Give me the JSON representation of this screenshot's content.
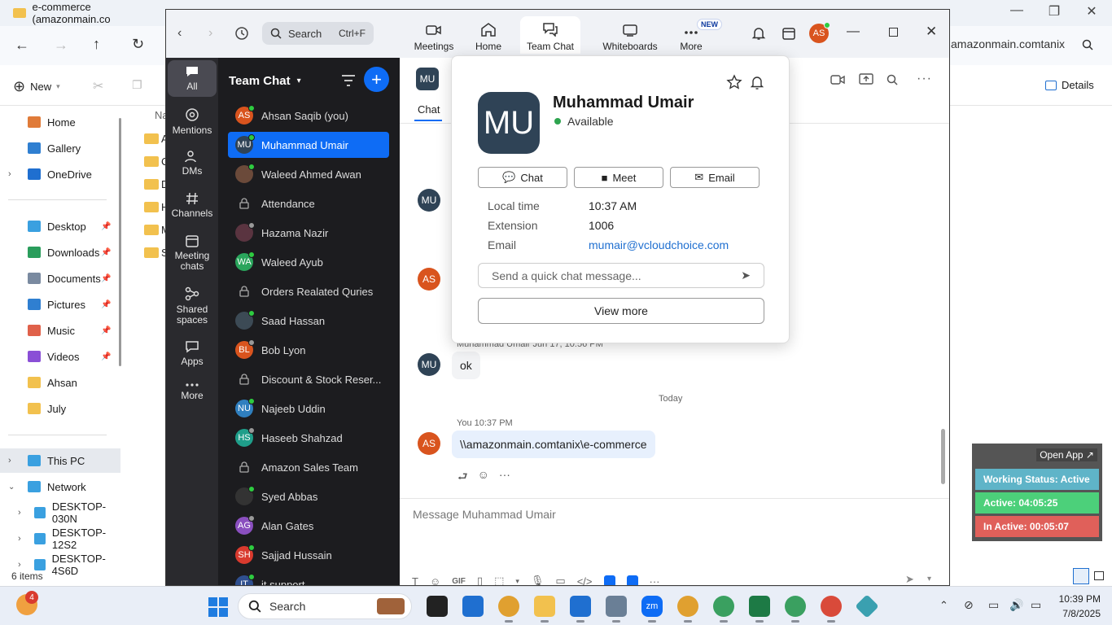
{
  "explorer": {
    "tab_title": "e-commerce (amazonmain.co",
    "address_tail": "amazonmain.comtanix",
    "new_label": "New",
    "details_label": "Details",
    "column_header": "Na",
    "status_items": "6 items",
    "folder_letters": [
      "A",
      "C",
      "D",
      "H",
      "M",
      "S"
    ],
    "sidebar": [
      {
        "label": "Home",
        "icon": "home-icon",
        "color": "#e07b39"
      },
      {
        "label": "Gallery",
        "icon": "gallery-icon",
        "color": "#2f7fd1"
      },
      {
        "label": "OneDrive",
        "icon": "cloud-icon",
        "color": "#1f6fd0"
      },
      {
        "label": "Desktop",
        "icon": "desktop-icon",
        "color": "#3aa0e0"
      },
      {
        "label": "Downloads",
        "icon": "download-icon",
        "color": "#2a9d5c"
      },
      {
        "label": "Documents",
        "icon": "document-icon",
        "color": "#7a8aa0"
      },
      {
        "label": "Pictures",
        "icon": "picture-icon",
        "color": "#2f7fd1"
      },
      {
        "label": "Music",
        "icon": "music-icon",
        "color": "#e0614a"
      },
      {
        "label": "Videos",
        "icon": "video-icon",
        "color": "#8a4fd6"
      },
      {
        "label": "Ahsan",
        "icon": "folder-icon",
        "color": "#f2c14e"
      },
      {
        "label": "July",
        "icon": "folder-icon",
        "color": "#f2c14e"
      },
      {
        "label": "This PC",
        "icon": "pc-icon",
        "color": "#3aa0e0"
      },
      {
        "label": "Network",
        "icon": "network-icon",
        "color": "#3aa0e0"
      },
      {
        "label": "DESKTOP-030N",
        "icon": "monitor-icon",
        "color": "#3aa0e0"
      },
      {
        "label": "DESKTOP-12S2",
        "icon": "monitor-icon",
        "color": "#3aa0e0"
      },
      {
        "label": "DESKTOP-4S6D",
        "icon": "monitor-icon",
        "color": "#3aa0e0"
      }
    ]
  },
  "zoom": {
    "search_label": "Search",
    "search_shortcut": "Ctrl+F",
    "nav": [
      {
        "label": "Meetings",
        "icon": "camera-icon"
      },
      {
        "label": "Home",
        "icon": "home-icon"
      },
      {
        "label": "Team Chat",
        "icon": "chat-icon"
      },
      {
        "label": "Whiteboards",
        "icon": "whiteboard-icon"
      },
      {
        "label": "More",
        "icon": "more-icon",
        "badge": "NEW"
      }
    ],
    "user_initials": "AS",
    "rail": [
      {
        "label": "All",
        "icon": "chat-bubble-icon"
      },
      {
        "label": "Mentions",
        "icon": "at-icon"
      },
      {
        "label": "DMs",
        "icon": "people-icon"
      },
      {
        "label": "Channels",
        "icon": "hash-icon"
      },
      {
        "label": "Meeting chats",
        "icon": "calendar-icon"
      },
      {
        "label": "Shared spaces",
        "icon": "share-icon"
      },
      {
        "label": "Apps",
        "icon": "apps-icon"
      },
      {
        "label": "More",
        "icon": "ellipsis-icon"
      }
    ],
    "list_title": "Team Chat",
    "contacts": [
      {
        "name": "Ahsan Saqib (you)",
        "initials": "AS",
        "color": "#d9541e",
        "dot": "#2ecc40",
        "type": "avatar"
      },
      {
        "name": "Muhammad Umair",
        "initials": "MU",
        "color": "#2f4356",
        "dot": "#2ecc40",
        "type": "avatar"
      },
      {
        "name": "Waleed Ahmed Awan",
        "initials": "",
        "color": "#6b4a3a",
        "dot": "#2ecc40",
        "type": "photo"
      },
      {
        "name": "Attendance",
        "initials": "",
        "color": "",
        "dot": "",
        "type": "channel"
      },
      {
        "name": "Hazama Nazir",
        "initials": "",
        "color": "#5a3440",
        "dot": "#999",
        "type": "photo"
      },
      {
        "name": "Waleed Ayub",
        "initials": "WA",
        "color": "#2aa55c",
        "dot": "#2ecc40",
        "type": "avatar"
      },
      {
        "name": "Orders Realated Quries",
        "initials": "",
        "color": "",
        "dot": "",
        "type": "channel"
      },
      {
        "name": "Saad Hassan",
        "initials": "",
        "color": "#3c4a55",
        "dot": "#2ecc40",
        "type": "photo"
      },
      {
        "name": "Bob Lyon",
        "initials": "BL",
        "color": "#d9541e",
        "dot": "#999",
        "type": "avatar"
      },
      {
        "name": "Discount & Stock Reser...",
        "initials": "",
        "color": "",
        "dot": "",
        "type": "channel"
      },
      {
        "name": "Najeeb Uddin",
        "initials": "NU",
        "color": "#2f7fbf",
        "dot": "#2ecc40",
        "type": "avatar"
      },
      {
        "name": "Haseeb Shahzad",
        "initials": "HS",
        "color": "#1f9e8a",
        "dot": "#999",
        "type": "avatar"
      },
      {
        "name": "Amazon Sales Team",
        "initials": "",
        "color": "",
        "dot": "",
        "type": "channel"
      },
      {
        "name": "Syed Abbas",
        "initials": "",
        "color": "#333",
        "dot": "#2ecc40",
        "type": "photo"
      },
      {
        "name": "Alan Gates",
        "initials": "AG",
        "color": "#8a4fbf",
        "dot": "#999",
        "type": "avatar"
      },
      {
        "name": "Sajjad Hussain",
        "initials": "SH",
        "color": "#d93a2e",
        "dot": "#2ecc40",
        "type": "avatar"
      },
      {
        "name": "it support",
        "initials": "IT",
        "color": "#2f4f8f",
        "dot": "#2ecc40",
        "type": "avatar"
      }
    ],
    "chat_header_initials": "MU",
    "chat_tab": "Chat",
    "messages": [
      {
        "meta": "Muhammad Umair  Jun 17, 10:56 PM",
        "text": "ok",
        "initials": "MU"
      },
      {
        "meta": "You  10:37 PM",
        "text": "\\\\amazonmain.comtanix\\e-commerce",
        "initials": "AS"
      }
    ],
    "day_divider": "Today",
    "composer_placeholder": "Message Muhammad Umair",
    "composer_gif": "GIF"
  },
  "popup": {
    "initials": "MU",
    "name": "Muhammad Umair",
    "status": "Available",
    "buttons": [
      "Chat",
      "Meet",
      "Email"
    ],
    "rows": [
      {
        "label": "Local time",
        "value": "10:37 AM"
      },
      {
        "label": "Extension",
        "value": "1006"
      },
      {
        "label": "Email",
        "value": "mumair@vcloudchoice.com"
      }
    ],
    "quick_placeholder": "Send a quick chat message...",
    "view_more": "View more"
  },
  "widget": {
    "open_app": "Open App ↗",
    "status": "Working Status: Active",
    "active": "Active: 04:05:25",
    "inactive": "In Active: 00:05:07",
    "colors": {
      "status": "#5fb4c8",
      "active": "#4cd07a",
      "inactive": "#e0605a"
    }
  },
  "taskbar": {
    "weather_badge": "4",
    "search": "Search",
    "time": "10:39 PM",
    "date": "7/8/2025"
  }
}
